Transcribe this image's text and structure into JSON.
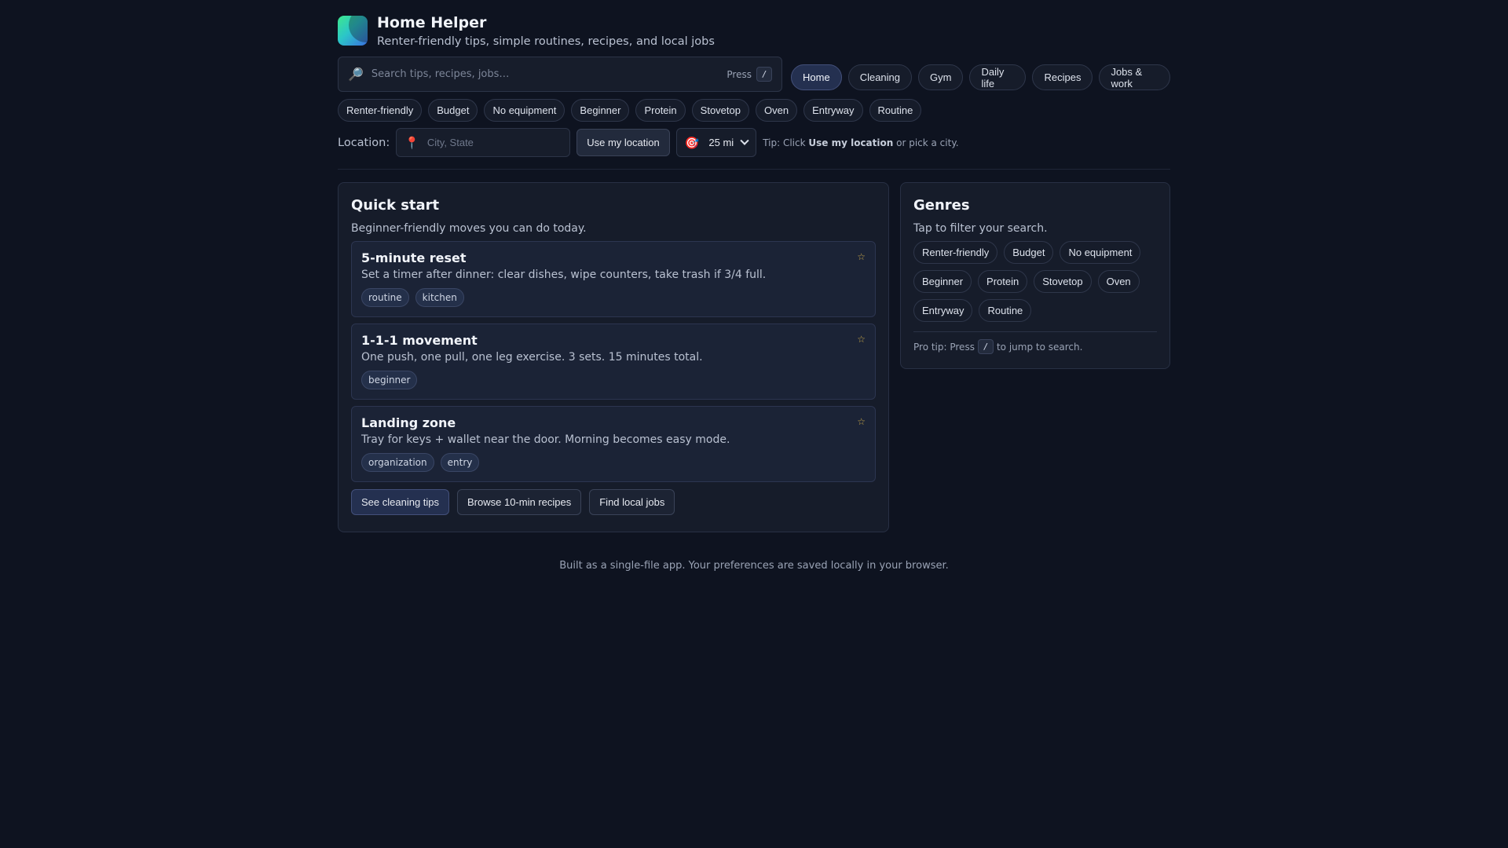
{
  "app": {
    "title": "Home Helper",
    "subtitle": "Renter-friendly tips, simple routines, recipes, and local jobs"
  },
  "search": {
    "placeholder": "Search tips, recipes, jobs…",
    "press_label": "Press",
    "shortcut": "/"
  },
  "nav": {
    "tabs": [
      {
        "label": "Home",
        "active": true
      },
      {
        "label": "Cleaning"
      },
      {
        "label": "Gym"
      },
      {
        "label": "Daily life"
      },
      {
        "label": "Recipes"
      },
      {
        "label": "Jobs & work"
      }
    ]
  },
  "filters": [
    "Renter-friendly",
    "Budget",
    "No equipment",
    "Beginner",
    "Protein",
    "Stovetop",
    "Oven",
    "Entryway",
    "Routine"
  ],
  "location": {
    "label": "Location:",
    "placeholder": "City, State",
    "use_location_button": "Use my location",
    "radius_value": "25 mi",
    "tip_prefix": "Tip: Click ",
    "tip_bold": "Use my location",
    "tip_suffix": " or pick a city."
  },
  "quick_start": {
    "title": "Quick start",
    "subtitle": "Beginner-friendly moves you can do today.",
    "cards": [
      {
        "title": "5-minute reset",
        "desc": "Set a timer after dinner: clear dishes, wipe counters, take trash if 3/4 full.",
        "tags": [
          "routine",
          "kitchen"
        ]
      },
      {
        "title": "1-1-1 movement",
        "desc": "One push, one pull, one leg exercise. 3 sets. 15 minutes total.",
        "tags": [
          "beginner"
        ]
      },
      {
        "title": "Landing zone",
        "desc": "Tray for keys + wallet near the door. Morning becomes easy mode.",
        "tags": [
          "organization",
          "entry"
        ]
      }
    ],
    "actions": [
      "See cleaning tips",
      "Browse 10-min recipes",
      "Find local jobs"
    ]
  },
  "genres": {
    "title": "Genres",
    "subtitle": "Tap to filter your search.",
    "items": [
      "Renter-friendly",
      "Budget",
      "No equipment",
      "Beginner",
      "Protein",
      "Stovetop",
      "Oven",
      "Entryway",
      "Routine"
    ],
    "pro_tip_prefix": "Pro tip: Press",
    "pro_tip_key": "/",
    "pro_tip_suffix": "to jump to search."
  },
  "footer": "Built as a single-file app. Your preferences are saved locally in your browser.",
  "colors": {
    "background": "#0e1320",
    "panel": "#161c2a",
    "accent_active": "#243050",
    "star": "#c9a84a",
    "pin": "#e4574c"
  },
  "icons": {
    "search": "magnifier-icon",
    "location": "pin-icon",
    "radius": "target-icon",
    "favorite": "star-icon"
  }
}
